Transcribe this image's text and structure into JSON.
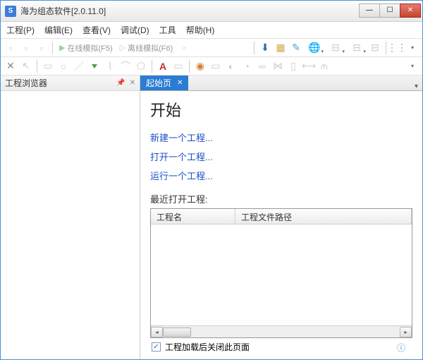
{
  "titlebar": {
    "icon_letter": "S",
    "title": "海为组态软件[2.0.11.0]"
  },
  "menubar": {
    "items": [
      "工程(P)",
      "编辑(E)",
      "查看(V)",
      "调试(D)",
      "工具",
      "帮助(H)"
    ]
  },
  "toolbar": {
    "online_sim": "在线模拟(F5)",
    "offline_sim": "离线模拟(F6)"
  },
  "sidebar": {
    "title": "工程浏览器"
  },
  "tab": {
    "label": "起始页"
  },
  "start_page": {
    "heading": "开始",
    "new_project": "新建一个工程...",
    "open_project": "打开一个工程...",
    "run_project": "运行一个工程...",
    "recent_label": "最近打开工程:",
    "col_name": "工程名",
    "col_path": "工程文件路径"
  },
  "footer": {
    "close_after_load": "工程加载后关闭此页面",
    "checked": true
  }
}
